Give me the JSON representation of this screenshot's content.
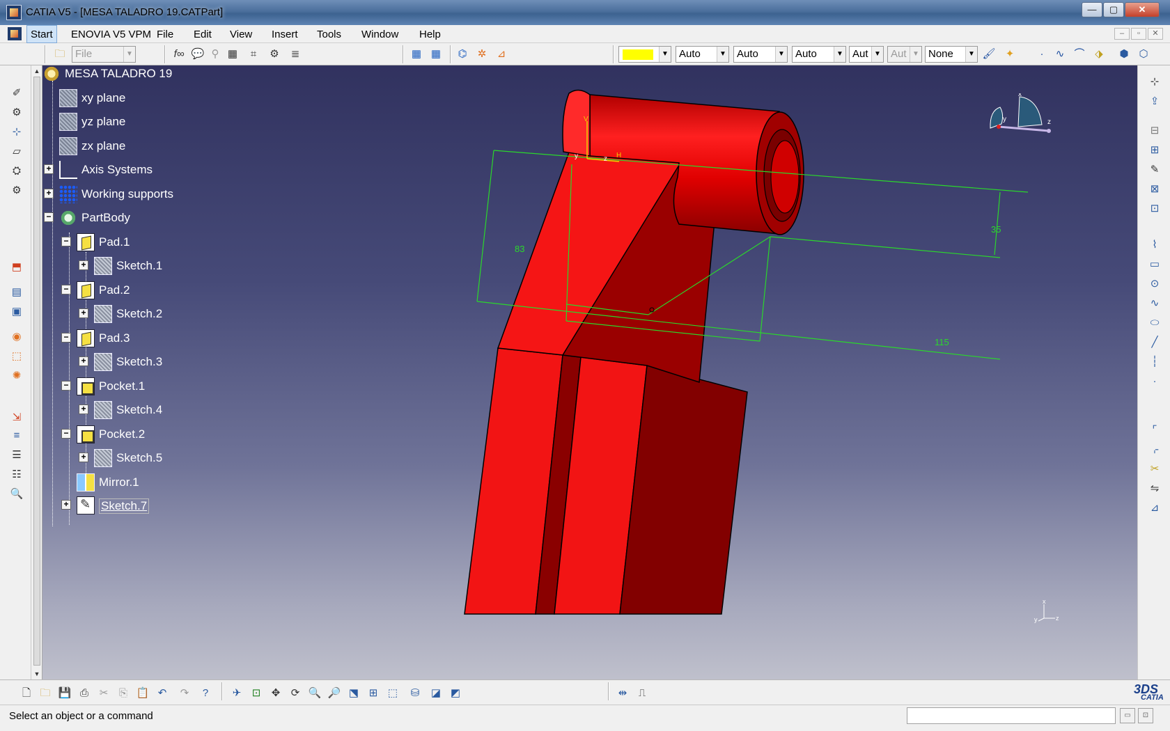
{
  "window": {
    "title": "CATIA V5 - [MESA TALADRO 19.CATPart]",
    "controls": {
      "minimize": "—",
      "maximize": "▢",
      "close": "✕"
    }
  },
  "menubar": {
    "items": [
      "Start",
      "ENOVIA V5 VPM",
      "File",
      "Edit",
      "View",
      "Insert",
      "Tools",
      "Window",
      "Help"
    ],
    "mdi_controls": [
      "–",
      "▫",
      "✕"
    ]
  },
  "toolbar": {
    "file_combo": "File",
    "color_swatch": "#ffff00",
    "linetype": "Auto",
    "thickness": "Auto",
    "layer": "Auto",
    "point_style": "Aut",
    "disabled_style": "Aut",
    "rendering": "None"
  },
  "tree": {
    "root": "MESA TALADRO 19",
    "nodes": [
      {
        "label": "xy plane",
        "icon": "plane-icon"
      },
      {
        "label": "yz plane",
        "icon": "plane-icon"
      },
      {
        "label": "zx plane",
        "icon": "plane-icon"
      },
      {
        "label": "Axis Systems",
        "icon": "axis-system-icon"
      },
      {
        "label": "Working supports",
        "icon": "grid-icon"
      },
      {
        "label": "PartBody",
        "icon": "partbody-icon"
      },
      {
        "label": "Pad.1",
        "icon": "pad-icon"
      },
      {
        "label": "Sketch.1",
        "icon": "sketch-icon"
      },
      {
        "label": "Pad.2",
        "icon": "pad-icon"
      },
      {
        "label": "Sketch.2",
        "icon": "sketch-icon"
      },
      {
        "label": "Pad.3",
        "icon": "pad-icon"
      },
      {
        "label": "Sketch.3",
        "icon": "sketch-icon"
      },
      {
        "label": "Pocket.1",
        "icon": "pocket-icon"
      },
      {
        "label": "Sketch.4",
        "icon": "sketch-icon"
      },
      {
        "label": "Pocket.2",
        "icon": "pocket-icon"
      },
      {
        "label": "Sketch.5",
        "icon": "sketch-icon"
      },
      {
        "label": "Mirror.1",
        "icon": "mirror-icon"
      },
      {
        "label": "Sketch.7",
        "icon": "sketch-icon"
      }
    ]
  },
  "viewport": {
    "dimensions": [
      "83",
      "35",
      "115"
    ],
    "part_color": "#ff1010",
    "dimension_color": "#22cc22",
    "compass_axes": [
      "x",
      "y",
      "z"
    ],
    "mini_axes": [
      "x",
      "y",
      "z"
    ],
    "sketch_axes": [
      "V",
      "H",
      "y",
      "z"
    ]
  },
  "statusbar": {
    "message": "Select an object or a command"
  },
  "logo": {
    "mark": "3DS",
    "text": "CATIA"
  }
}
